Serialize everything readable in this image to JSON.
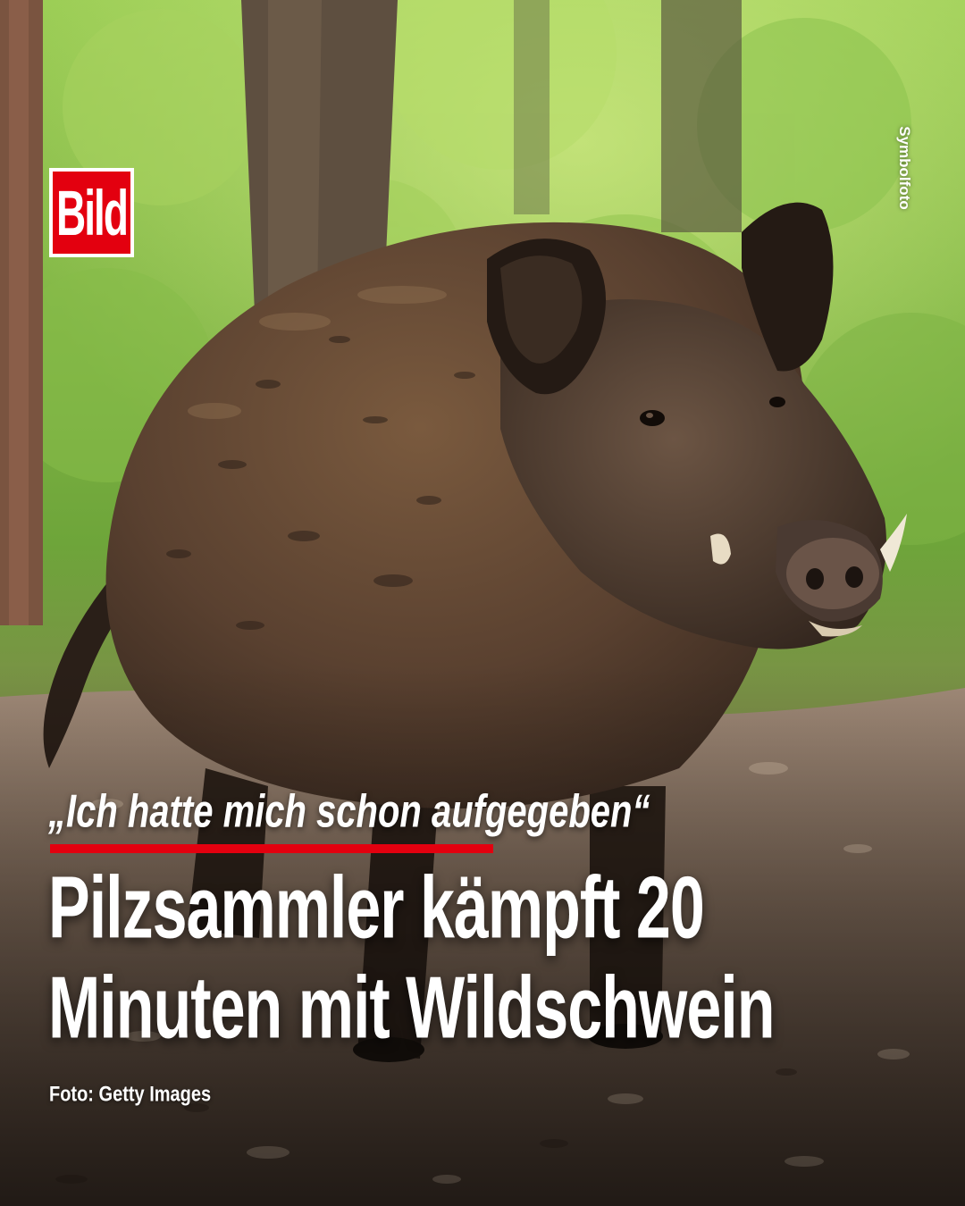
{
  "logo": {
    "text": "Bild",
    "color": "#e3000f"
  },
  "label_symbol": "Symbolfoto",
  "kicker": "„Ich hatte mich schon aufgegeben“",
  "headline": {
    "line1": "Pilzsammler kämpft 20",
    "line2": "Minuten mit Wildschwein"
  },
  "credit": "Foto: Getty Images",
  "colors": {
    "accent": "#e3000f",
    "text": "#ffffff"
  }
}
